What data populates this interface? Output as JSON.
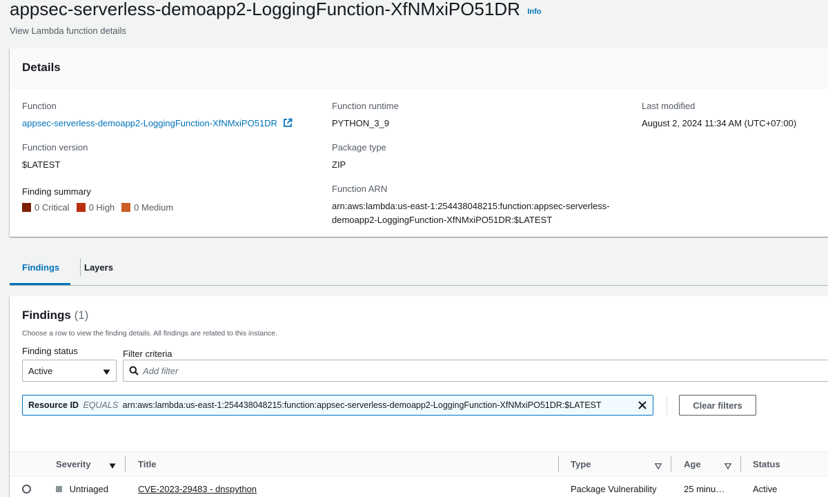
{
  "header": {
    "title": "appsec-serverless-demoapp2-LoggingFunction-XfNMxiPO51DR",
    "info": "Info",
    "description": "View Lambda function details"
  },
  "details": {
    "heading": "Details",
    "function_label": "Function",
    "function_value": "appsec-serverless-demoapp2-LoggingFunction-XfNMxiPO51DR",
    "version_label": "Function version",
    "version_value": "$LATEST",
    "summary_label": "Finding summary",
    "summary": [
      {
        "label": "0 Critical",
        "color": "#7d2105"
      },
      {
        "label": "0 High",
        "color": "#ba2e0f"
      },
      {
        "label": "0 Medium",
        "color": "#cc5f21"
      }
    ],
    "runtime_label": "Function runtime",
    "runtime_value": "PYTHON_3_9",
    "package_label": "Package type",
    "package_value": "ZIP",
    "arn_label": "Function ARN",
    "arn_line1": "arn:aws:lambda:us-east-1:254438048215:function:appsec-serverless-",
    "arn_line2": "demoapp2-LoggingFunction-XfNMxiPO51DR:$LATEST",
    "modified_label": "Last modified",
    "modified_value": "August 2, 2024 11:34 AM (UTC+07:00)"
  },
  "tabs": [
    {
      "label": "Findings",
      "active": true
    },
    {
      "label": "Layers",
      "active": false
    }
  ],
  "findings": {
    "title": "Findings",
    "count": "(1)",
    "description": "Choose a row to view the finding details. All findings are related to this instance.",
    "status_label": "Finding status",
    "status_value": "Active",
    "filter_label": "Filter criteria",
    "filter_placeholder": "Add filter",
    "token_key": "Resource ID",
    "token_op": "EQUALS",
    "token_value": "arn:aws:lambda:us-east-1:254438048215:function:appsec-serverless-demoapp2-LoggingFunction-XfNMxiPO51DR:$LATEST",
    "clear_filters": "Clear filters",
    "columns": {
      "severity": "Severity",
      "title": "Title",
      "type": "Type",
      "age": "Age",
      "status": "Status"
    },
    "rows": [
      {
        "severity": "Untriaged",
        "title": "CVE-2023-29483 - dnspython",
        "type": "Package Vulnerability",
        "age": "25 minu…",
        "status": "Active"
      }
    ]
  }
}
